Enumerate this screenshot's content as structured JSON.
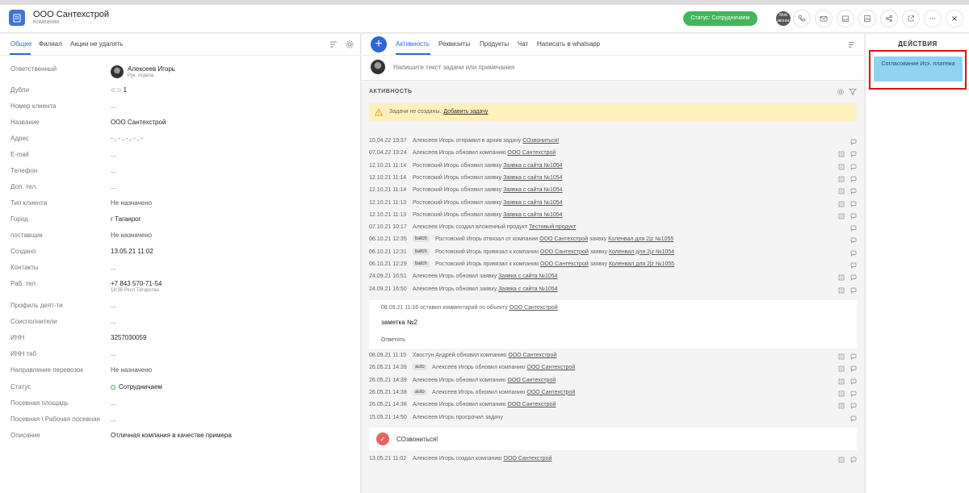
{
  "header": {
    "title": "ООО Сантехстрой",
    "subtitle": "Компании",
    "status_label": "Статус: Сотрудничаем",
    "avatar_text": "Мой звонок"
  },
  "left_tabs": [
    "Общие",
    "Филиал",
    "Акции не удалять"
  ],
  "fields": [
    {
      "label": "Ответственный",
      "value": "Алексеев Игорь",
      "sub": "Рук. отдела"
    },
    {
      "label": "Дубли",
      "value": "1"
    },
    {
      "label": "Номер клиента",
      "value": "..."
    },
    {
      "label": "Название",
      "value": "ООО Сантехстрой"
    },
    {
      "label": "Адрес",
      "value": "- , - , - , - , -"
    },
    {
      "label": "E-mail",
      "value": "..."
    },
    {
      "label": "Телефон",
      "value": "..."
    },
    {
      "label": "Доп. тел.",
      "value": "..."
    },
    {
      "label": "Тип клиента",
      "value": "Не назначено"
    },
    {
      "label": "Город",
      "value": "г Таганрог"
    },
    {
      "label": "поставщик",
      "value": "Не назначено"
    },
    {
      "label": "Создано",
      "value": "13.05.21 11:02"
    },
    {
      "label": "Контакты",
      "value": "..."
    },
    {
      "label": "Раб. тел.",
      "value": "+7 843 570-71-54",
      "sub": "18:36 Респ Татарстан"
    },
    {
      "label": "Профиль деят-ти",
      "value": "..."
    },
    {
      "label": "Соисполнители",
      "value": "..."
    },
    {
      "label": "ИНН",
      "value": "3257030059"
    },
    {
      "label": "ИНН таб",
      "value": "..."
    },
    {
      "label": "Направление перевозок",
      "value": "Не назначено"
    },
    {
      "label": "Статус",
      "value": "Сотрудничаем"
    },
    {
      "label": "Посевная площадь",
      "value": "..."
    },
    {
      "label": "Посевная \\ Рабочая посевная",
      "value": "..."
    },
    {
      "label": "Описание",
      "value": "Отличная компания в качестве примера"
    }
  ],
  "mid_tabs": [
    "Активность",
    "Реквизиты",
    "Продукты",
    "Чат",
    "Написать в whatsapp"
  ],
  "compose_placeholder": "Напишите текст задачи или примечания",
  "activity_title": "АКТИВНОСТЬ",
  "warning": {
    "text": "Задачи не созданы.",
    "link": "Добавить задачу"
  },
  "log": [
    {
      "time": "10.04.22 19:37",
      "text": "Алексеев Игорь отправил в архив задачу",
      "link": "СОзвониться!",
      "note": false
    },
    {
      "time": "07.04.22 13:24",
      "text": "Алексеев Игорь обновил компанию",
      "link": "ООО Сантехстрой",
      "note": true
    },
    {
      "time": "12.10.21 11:14",
      "text": "Ростовский Игорь обновил заявку",
      "link": "Заявка с сайта №1054",
      "note": true
    },
    {
      "time": "12.10.21 11:14",
      "text": "Ростовский Игорь обновил заявку",
      "link": "Заявка с сайта №1054",
      "note": true
    },
    {
      "time": "12.10.21 11:14",
      "text": "Ростовский Игорь обновил заявку",
      "link": "Заявка с сайта №1054",
      "note": true
    },
    {
      "time": "12.10.21 11:13",
      "text": "Ростовский Игорь обновил заявку",
      "link": "Заявка с сайта №1054",
      "note": true
    },
    {
      "time": "12.10.21 11:13",
      "text": "Ростовский Игорь обновил заявку",
      "link": "Заявка с сайта №1054",
      "note": true
    },
    {
      "time": "07.10.21 10:17",
      "text": "Алексеев Игорь создал вложенный продукт",
      "link": "Тестовый продукт",
      "note": false
    },
    {
      "time": "06.10.21 12:35",
      "tag": "batch",
      "text": "Ростовский Игорь отвязал от компании",
      "link": "ООО Сантехстрой",
      "text2": "заявку",
      "link2": "Коленвал для 2jz №1055",
      "note": false
    },
    {
      "time": "06.10.21 12:31",
      "tag": "batch",
      "text": "Ростовский Игорь привязал к компании",
      "link": "ООО Сантехстрой",
      "text2": "заявку",
      "link2": "Коленвал для 2jz №1054",
      "note": false
    },
    {
      "time": "06.10.21 12:29",
      "tag": "batch",
      "text": "Ростовский Игорь привязал к компании",
      "link": "ООО Сантехстрой",
      "text2": "заявку",
      "link2": "Коленвал для 2jz №1055",
      "note": false
    },
    {
      "time": "24.09.21 16:51",
      "text": "Алексеев Игорь обновил заявку",
      "link": "Заявка с сайта №1054",
      "note": true
    },
    {
      "time": "24.09.21 16:50",
      "text": "Алексеев Игорь обновил заявку",
      "link": "Заявка с сайта №1054",
      "note": true
    }
  ],
  "comment": {
    "head": "08.09.21 11:16 оставил комментарий по объекту",
    "link": "ООО Сантехстрой",
    "body": "заметка №2",
    "reply": "Ответить"
  },
  "log2": [
    {
      "time": "08.09.21 11:15",
      "text": "Хвостун Андрей обновил компанию",
      "link": "ООО Сантехстрой",
      "note": true
    },
    {
      "time": "26.05.21 14:39",
      "tag": "auto",
      "text": "Алексеев Игорь обновил компанию",
      "link": "ООО Сантехстрой",
      "note": true
    },
    {
      "time": "26.05.21 14:39",
      "text": "Алексеев Игорь обновил компанию",
      "link": "ООО Сантехстрой",
      "note": true
    },
    {
      "time": "26.05.21 14:38",
      "tag": "auto",
      "text": "Алексеев Игорь обновил компанию",
      "link": "ООО Сантехстрой",
      "note": true
    },
    {
      "time": "26.05.21 14:38",
      "text": "Алексеев Игорь обновил компанию",
      "link": "ООО Сантехстрой",
      "note": true
    },
    {
      "time": "15.05.21 14:50",
      "text": "Алексеев Игорь просрочил задачу",
      "note": false
    }
  ],
  "task": {
    "text": "СОзвониться!"
  },
  "log3": [
    {
      "time": "13.05.21 11:02",
      "text": "Алексеев Игорь создал компанию",
      "link": "ООО Сантехстрой",
      "note": true
    }
  ],
  "right_panel": {
    "title": "ДЕЙСТВИЯ",
    "action": "Согласование Исх. платежа"
  }
}
